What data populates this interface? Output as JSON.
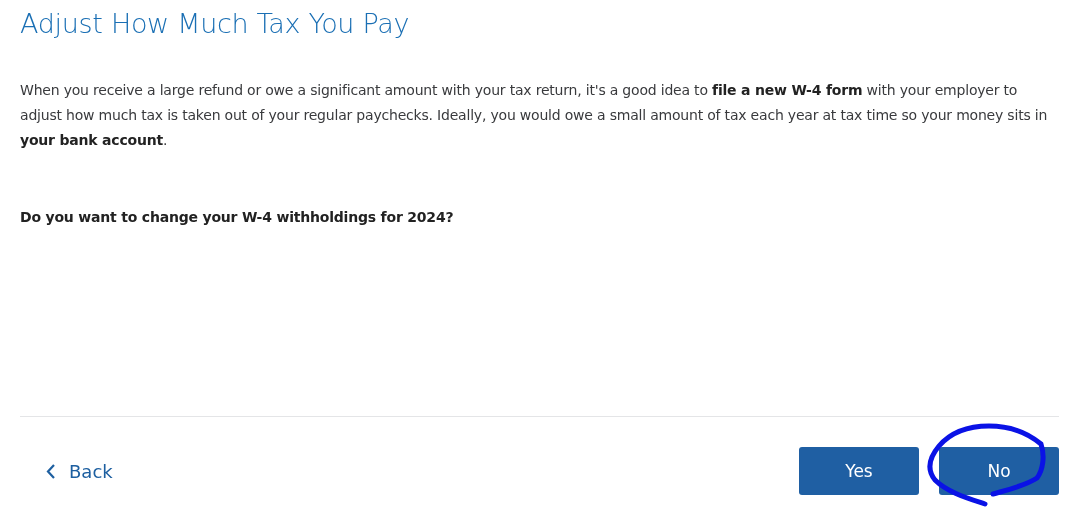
{
  "title": "Adjust How Much Tax You Pay",
  "intro": "When you receive a large refund or owe a significant amount with your tax return, it's a good idea to **file a new W-4 form** with your employer to adjust how much tax is taken out of your regular paychecks. Ideally, you would owe a small amount of tax each year at tax time so your money sits in **your bank account**.",
  "question": "Do you want to change your W-4 withholdings for 2024?",
  "back": {
    "label": "Back"
  },
  "buttons": [
    {
      "label": "Yes",
      "circled": false
    },
    {
      "label": "No",
      "circled": true
    }
  ]
}
